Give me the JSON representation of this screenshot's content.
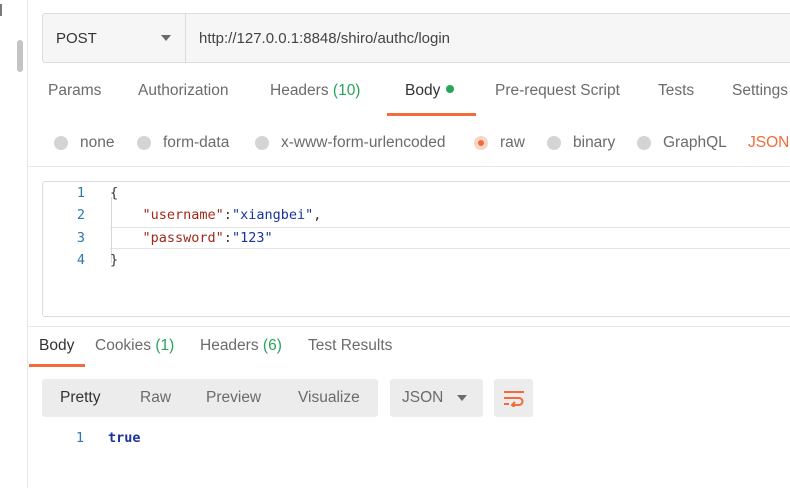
{
  "request": {
    "method": "POST",
    "url": "http://127.0.0.1:8848/shiro/authc/login"
  },
  "request_tabs": [
    {
      "label": "Params"
    },
    {
      "label": "Authorization"
    },
    {
      "label": "Headers",
      "count": "(10)"
    },
    {
      "label": "Body",
      "active": true
    },
    {
      "label": "Pre-request Script"
    },
    {
      "label": "Tests"
    },
    {
      "label": "Settings"
    }
  ],
  "body_types": [
    {
      "label": "none"
    },
    {
      "label": "form-data"
    },
    {
      "label": "x-www-form-urlencoded"
    },
    {
      "label": "raw",
      "checked": true
    },
    {
      "label": "binary"
    },
    {
      "label": "GraphQL"
    }
  ],
  "raw_type": "JSON",
  "editor": {
    "lines": [
      {
        "n": "1",
        "text": "{"
      },
      {
        "n": "2",
        "key": "\"username\"",
        "sep": ":",
        "value": "\"xiangbei\"",
        "tail": ","
      },
      {
        "n": "3",
        "key": "\"password\"",
        "sep": ":",
        "value": "\"123\"",
        "tail": ""
      },
      {
        "n": "4",
        "text": "}"
      }
    ]
  },
  "response_tabs": [
    {
      "label": "Body",
      "active": true
    },
    {
      "label": "Cookies",
      "count": "(1)"
    },
    {
      "label": "Headers",
      "count": "(6)"
    },
    {
      "label": "Test Results"
    }
  ],
  "view_modes": [
    {
      "label": "Pretty",
      "active": true
    },
    {
      "label": "Raw"
    },
    {
      "label": "Preview"
    },
    {
      "label": "Visualize"
    }
  ],
  "response_format": "JSON",
  "response_body": {
    "n": "1",
    "value": "true"
  },
  "colors": {
    "accent": "#f26b3a",
    "count_green": "#26a65b",
    "json_key": "#a0291a",
    "json_string": "#17349a",
    "line_number": "#2a7ab0"
  },
  "icons": {
    "method_dropdown": "chevron-down-icon",
    "format_dropdown": "chevron-down-icon",
    "wrap": "wrap-lines-icon"
  }
}
